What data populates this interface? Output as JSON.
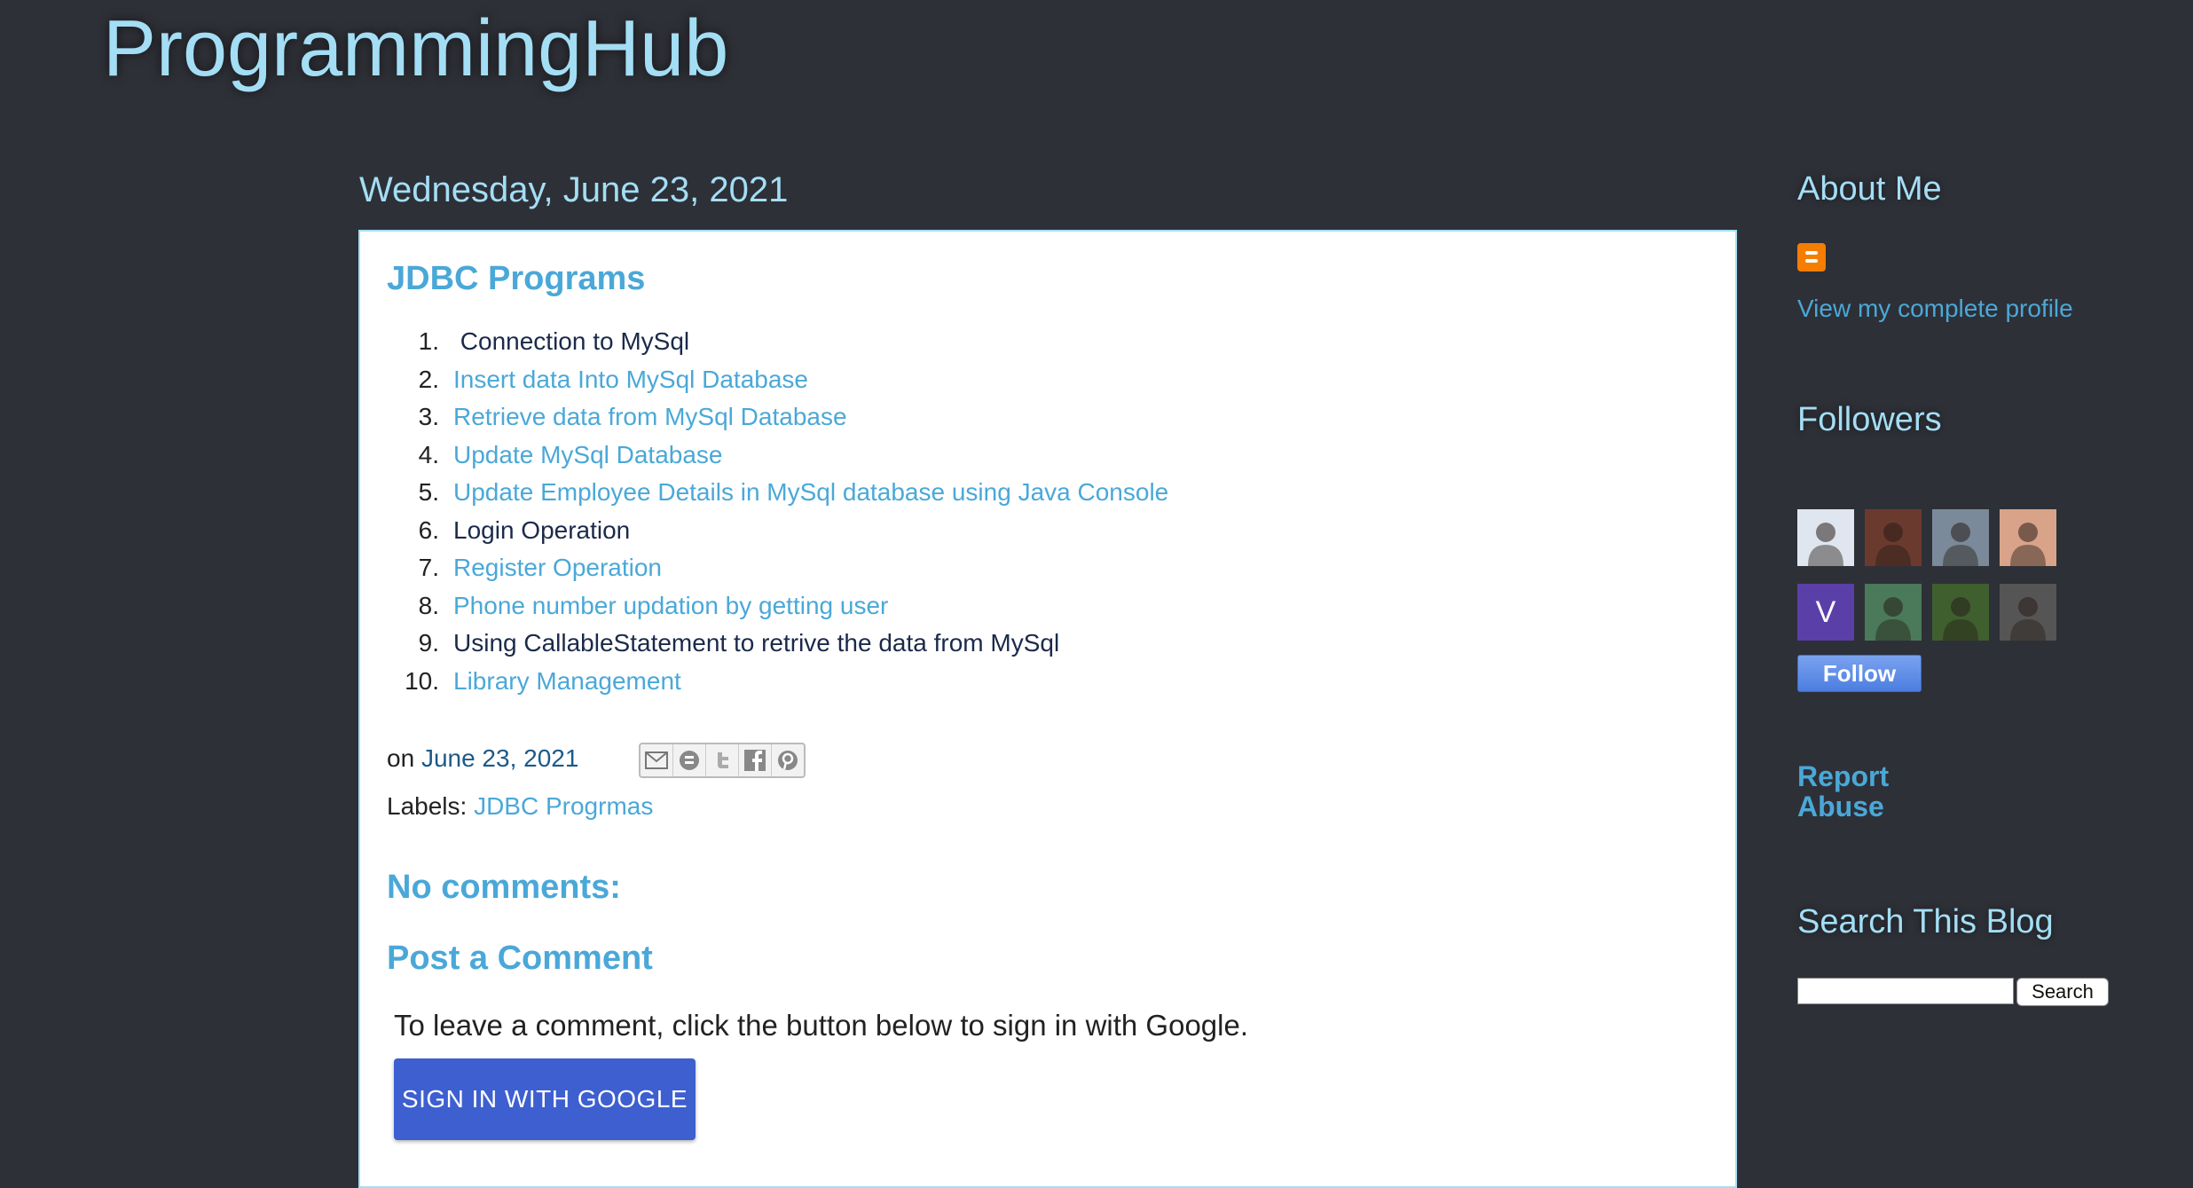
{
  "header": {
    "blog_title": "ProgrammingHub"
  },
  "post": {
    "date": "Wednesday, June 23, 2021",
    "title": "JDBC Programs",
    "items": [
      {
        "num": "1.",
        "label": " Connection to MySql",
        "link": false
      },
      {
        "num": "2.",
        "label": "Insert data Into MySql Database",
        "link": true
      },
      {
        "num": "3.",
        "label": "Retrieve data from MySql Database",
        "link": true
      },
      {
        "num": "4.",
        "label": "Update MySql Database",
        "link": true
      },
      {
        "num": "5.",
        "label": "Update Employee Details in MySql database using Java Console",
        "link": true
      },
      {
        "num": "6.",
        "label": "Login Operation",
        "link": false
      },
      {
        "num": "7.",
        "label": "Register Operation",
        "link": true
      },
      {
        "num": "8.",
        "label": "Phone number updation by getting user",
        "link": true
      },
      {
        "num": "9.",
        "label": "Using CallableStatement to retrive the data from MySql",
        "link": false
      },
      {
        "num": "10.",
        "label": "Library Management",
        "link": true
      }
    ],
    "on_prefix": "on",
    "post_date_link": "June 23, 2021",
    "share_icons": [
      "email-icon",
      "blogger-icon",
      "twitter-icon",
      "facebook-icon",
      "pinterest-icon"
    ],
    "labels_prefix": "Labels:",
    "label_link": "JDBC Progrmas"
  },
  "comments": {
    "no_comments": "No comments:",
    "post_a_comment": "Post a Comment",
    "hint": "To leave a comment, click the button below to sign in with Google.",
    "signin_label": "SIGN IN WITH GOOGLE"
  },
  "sidebar": {
    "about_heading": "About Me",
    "profile_link": "View my complete profile",
    "followers_heading": "Followers",
    "followers": [
      {
        "name": "follower-1",
        "color": "#dfe6ef"
      },
      {
        "name": "follower-2",
        "color": "#6b3a2e"
      },
      {
        "name": "follower-3",
        "color": "#7a8a9a"
      },
      {
        "name": "follower-4",
        "color": "#d9a38a"
      },
      {
        "name": "follower-5",
        "color": "#5b3fa8",
        "initial": "V"
      },
      {
        "name": "follower-6",
        "color": "#4a7a5a"
      },
      {
        "name": "follower-7",
        "color": "#3f5f2f"
      },
      {
        "name": "follower-8",
        "color": "#555555"
      }
    ],
    "follow_label": "Follow",
    "report_label": "Report Abuse",
    "search_heading": "Search This Blog",
    "search_button": "Search"
  }
}
